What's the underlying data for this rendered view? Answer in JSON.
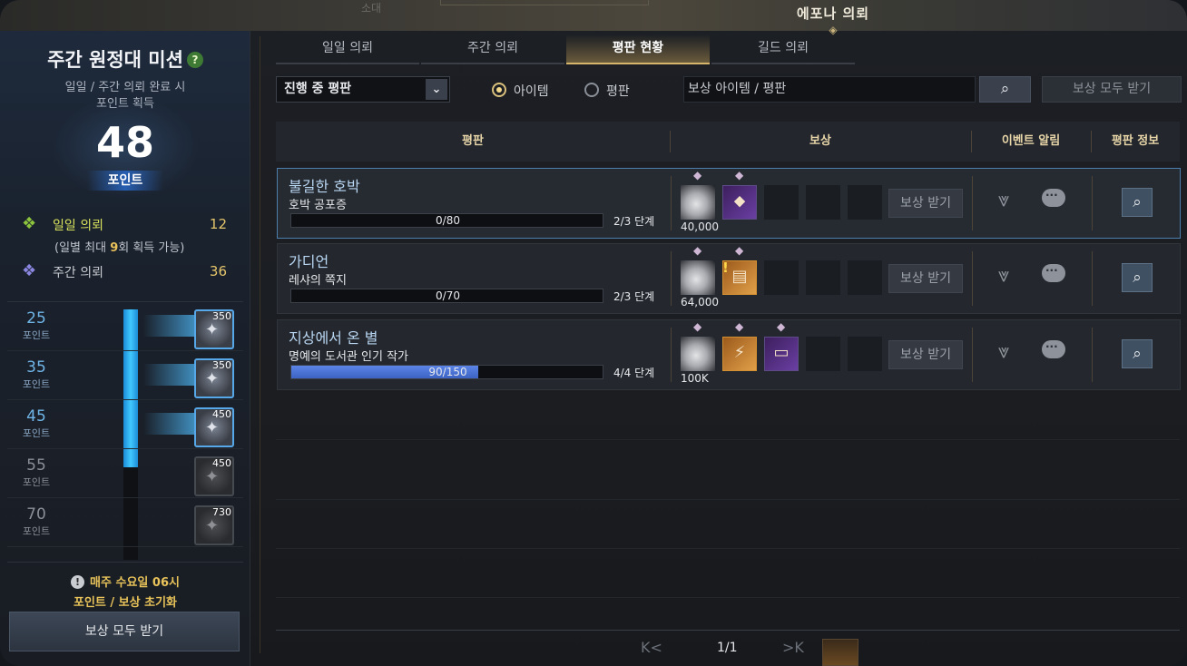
{
  "window": {
    "title": "에포나 의뢰",
    "ghost_text": "소대"
  },
  "mission": {
    "title": "주간 원정대 미션",
    "help_icon": "?",
    "subtitle_line1": "일일 / 주간 의뢰 완료 시",
    "subtitle_line2": "포인트 획득",
    "points": "48",
    "points_label": "포인트",
    "daily": {
      "label": "일일 의뢰",
      "value": "12",
      "note_prefix": "(일별 최대 ",
      "note_count": "9",
      "note_suffix": "회 획득 가능)"
    },
    "weekly": {
      "label": "주간 의뢰",
      "value": "36"
    },
    "tiers": [
      {
        "points": "25",
        "unit": "포인트",
        "reward_count": "350",
        "unlocked": true
      },
      {
        "points": "35",
        "unit": "포인트",
        "reward_count": "350",
        "unlocked": true
      },
      {
        "points": "45",
        "unit": "포인트",
        "reward_count": "450",
        "unlocked": true
      },
      {
        "points": "55",
        "unit": "포인트",
        "reward_count": "450",
        "unlocked": false
      },
      {
        "points": "70",
        "unit": "포인트",
        "reward_count": "730",
        "unlocked": false
      }
    ],
    "progress_fraction": 0.63,
    "reset_line1": "매주 수요일 06시",
    "reset_line2": "포인트 / 보상 초기화",
    "warn_icon": "!",
    "claim_all": "보상 모두 받기"
  },
  "tabs": [
    {
      "label": "일일 의뢰",
      "active": false
    },
    {
      "label": "주간 의뢰",
      "active": false
    },
    {
      "label": "평판 현황",
      "active": true
    },
    {
      "label": "길드 의뢰",
      "active": false
    }
  ],
  "filters": {
    "select_value": "진행 중 평판",
    "select_arrow": "⌄",
    "radio_item": "아이템",
    "radio_rep": "평판",
    "search_placeholder": "보상 아이템 / 평판",
    "search_icon": "⌕",
    "claim_all": "보상 모두 받기"
  },
  "table": {
    "headers": {
      "rep": "평판",
      "reward": "보상",
      "event": "이벤트 알림",
      "info": "평판 정보"
    },
    "claim_label": "보상 받기",
    "rows": [
      {
        "name": "불길한 호박",
        "stage": "호박 공포증",
        "progress_text": "0/80",
        "progress": 0,
        "level": "2/3 단계",
        "amount": "40,000",
        "selected": true
      },
      {
        "name": "가디언",
        "stage": "레샤의 쪽지",
        "progress_text": "0/70",
        "progress": 0,
        "level": "2/3 단계",
        "amount": "64,000",
        "selected": false
      },
      {
        "name": "지상에서 온 별",
        "stage": "명예의 도서관 인기 작가",
        "progress_text": "90/150",
        "progress": 0.6,
        "level": "4/4 단계",
        "amount": "100K",
        "selected": false
      }
    ]
  },
  "pager": {
    "first": "K",
    "prev": "<",
    "page": "1/1",
    "next": ">",
    "last": "K"
  },
  "icons": {
    "daily": "diamond-icon",
    "weekly": "diamond-icon",
    "pin": "pin-icon",
    "alert": "chevron-double-down-icon",
    "chat": "chat-bubble-icon",
    "info": "magnifier-icon"
  },
  "colors": {
    "accent_gold": "#d6b46a",
    "progress_blue": "#3d63c4",
    "tier_blue": "#41c9ff"
  }
}
